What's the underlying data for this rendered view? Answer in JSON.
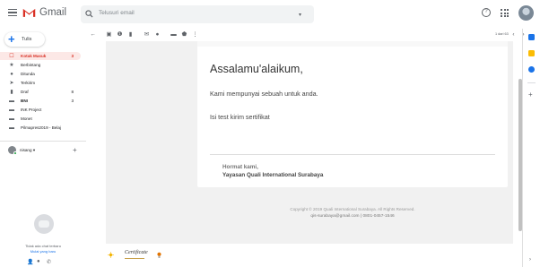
{
  "app": {
    "name": "Gmail",
    "brand_color": "#d93025",
    "accent_color": "#1a73e8"
  },
  "header": {
    "search_placeholder": "Telusuri email",
    "help_icon": "question-icon",
    "apps_icon": "grid-icon",
    "avatar_icon": "account-avatar"
  },
  "sidebar": {
    "compose_label": "Tulis",
    "items": [
      {
        "label": "Kotak Masuk",
        "count": "3",
        "icon": "inbox-icon",
        "active": true
      },
      {
        "label": "Berbintang",
        "count": "",
        "icon": "star-icon",
        "active": false
      },
      {
        "label": "Ditunda",
        "count": "",
        "icon": "clock-icon",
        "active": false
      },
      {
        "label": "Terkirim",
        "count": "",
        "icon": "send-icon",
        "active": false
      },
      {
        "label": "Draf",
        "count": "8",
        "icon": "draft-icon",
        "active": false
      },
      {
        "label": "BNI",
        "count": "3",
        "icon": "label-icon",
        "active": false
      },
      {
        "label": "INK Project",
        "count": "",
        "icon": "label-icon",
        "active": false
      },
      {
        "label": "Monet",
        "count": "",
        "icon": "label-icon",
        "active": false
      },
      {
        "label": "Pilmapres2019 - Belaj",
        "count": "",
        "icon": "label-icon",
        "active": false
      }
    ],
    "hangouts_user": "nisang",
    "hangouts_caret": "▾",
    "chat_empty_text": "Tidak ada chat terbaru",
    "chat_start_link": "Mulai yang baru"
  },
  "toolbar": {
    "pager_text": "1 dari 63",
    "icons": [
      "back-arrow-icon",
      "archive-icon",
      "report-spam-icon",
      "delete-icon",
      "mark-unread-icon",
      "snooze-icon",
      "move-to-icon",
      "labels-icon",
      "more-icon"
    ]
  },
  "email": {
    "greeting": "Assalamu'alaikum,",
    "line1": "Kami mempunyai sebuah untuk anda.",
    "line2": "Isi test kirim sertifikat",
    "signature_regards": "Hormat kami,",
    "signature_company": "Yayasan Quali International Surabaya",
    "copyright": "Copyright © 2019 Quali International Surabaya. All Rights Reserved.",
    "contact": "qis-surabaya@gmail.com  |  0801-0457-1546"
  },
  "attachments": {
    "name": "Certificate"
  },
  "right_panel": {
    "icons": [
      "calendar-icon",
      "keep-icon",
      "tasks-icon"
    ],
    "colors": [
      "#1a73e8",
      "#fbbc04",
      "#1a73e8"
    ]
  }
}
